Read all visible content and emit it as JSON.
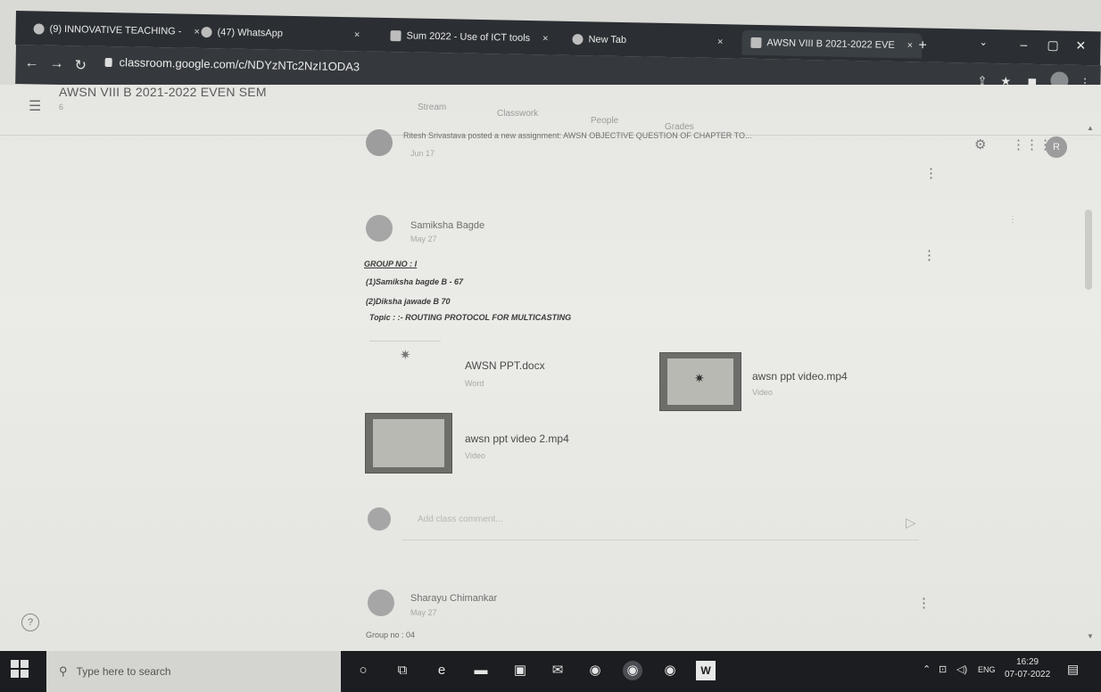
{
  "browser": {
    "tabs": [
      {
        "label": "(9) INNOVATIVE TEACHING -",
        "close": "×"
      },
      {
        "label": "(47) WhatsApp",
        "close": "×"
      },
      {
        "label": "Sum 2022 - Use of ICT tools",
        "close": "×"
      },
      {
        "label": "New Tab",
        "close": "×"
      },
      {
        "label": "AWSN VIII B 2021-2022 EVE",
        "close": "×"
      }
    ],
    "new_tab": "+",
    "url": "classroom.google.com/c/NDYzNTc2NzI1ODA3"
  },
  "classroom": {
    "title": "AWSN VIII B 2021-2022 EVEN SEM",
    "subtitle": "6",
    "tabs": [
      "Stream",
      "Classwork",
      "People",
      "Grades"
    ],
    "top_post_text": "Ritesh Srivastava posted a new assignment: AWSN OBJECTIVE QUESTION OF CHAPTER TO...",
    "top_post_date": "Jun 17"
  },
  "post1": {
    "author": "Samiksha Bagde",
    "date": "May 27",
    "group_line": "GROUP NO : I",
    "member1": "(1)Samiksha bagde B - 67",
    "member2": "(2)Diksha jawade B 70",
    "topic": "Topic : :- ROUTING PROTOCOL FOR MULTICASTING",
    "attachments": [
      {
        "title": "AWSN PPT.docx",
        "type": "Word"
      },
      {
        "title": "awsn ppt video.mp4",
        "type": "Video"
      },
      {
        "title": "awsn ppt video 2.mp4",
        "type": "Video"
      }
    ],
    "comment_placeholder": "Add class comment..."
  },
  "post2": {
    "author": "Sharayu Chimankar",
    "date": "May 27",
    "text": "Group no : 04"
  },
  "taskbar": {
    "search_placeholder": "Type here to search",
    "lang": "ENG",
    "time": "16:29",
    "date": "07-07-2022"
  }
}
